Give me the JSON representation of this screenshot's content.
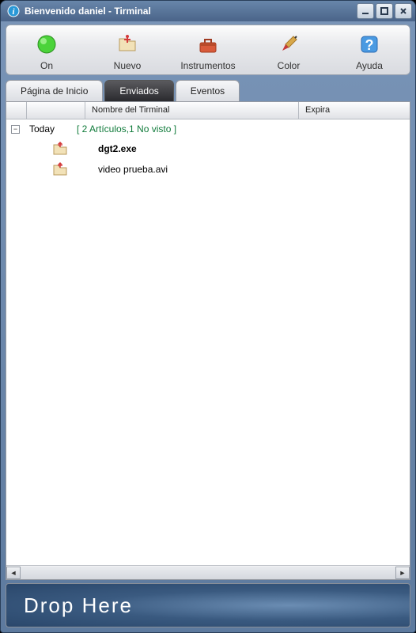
{
  "window": {
    "title": "Bienvenido daniel - Tirminal"
  },
  "toolbar": {
    "on": "On",
    "nuevo": "Nuevo",
    "instrumentos": "Instrumentos",
    "color": "Color",
    "ayuda": "Ayuda"
  },
  "tabs": {
    "home": "Página de Inicio",
    "sent": "Enviados",
    "events": "Eventos"
  },
  "columns": {
    "name": "Nombre del Tirminal",
    "expires": "Expira"
  },
  "group": {
    "day": "Today",
    "meta": "[ 2 Artículos,1 No visto ]"
  },
  "files": [
    {
      "name": "dgt2.exe",
      "unread": true
    },
    {
      "name": "video prueba.avi",
      "unread": false
    }
  ],
  "drop": "Drop Here"
}
